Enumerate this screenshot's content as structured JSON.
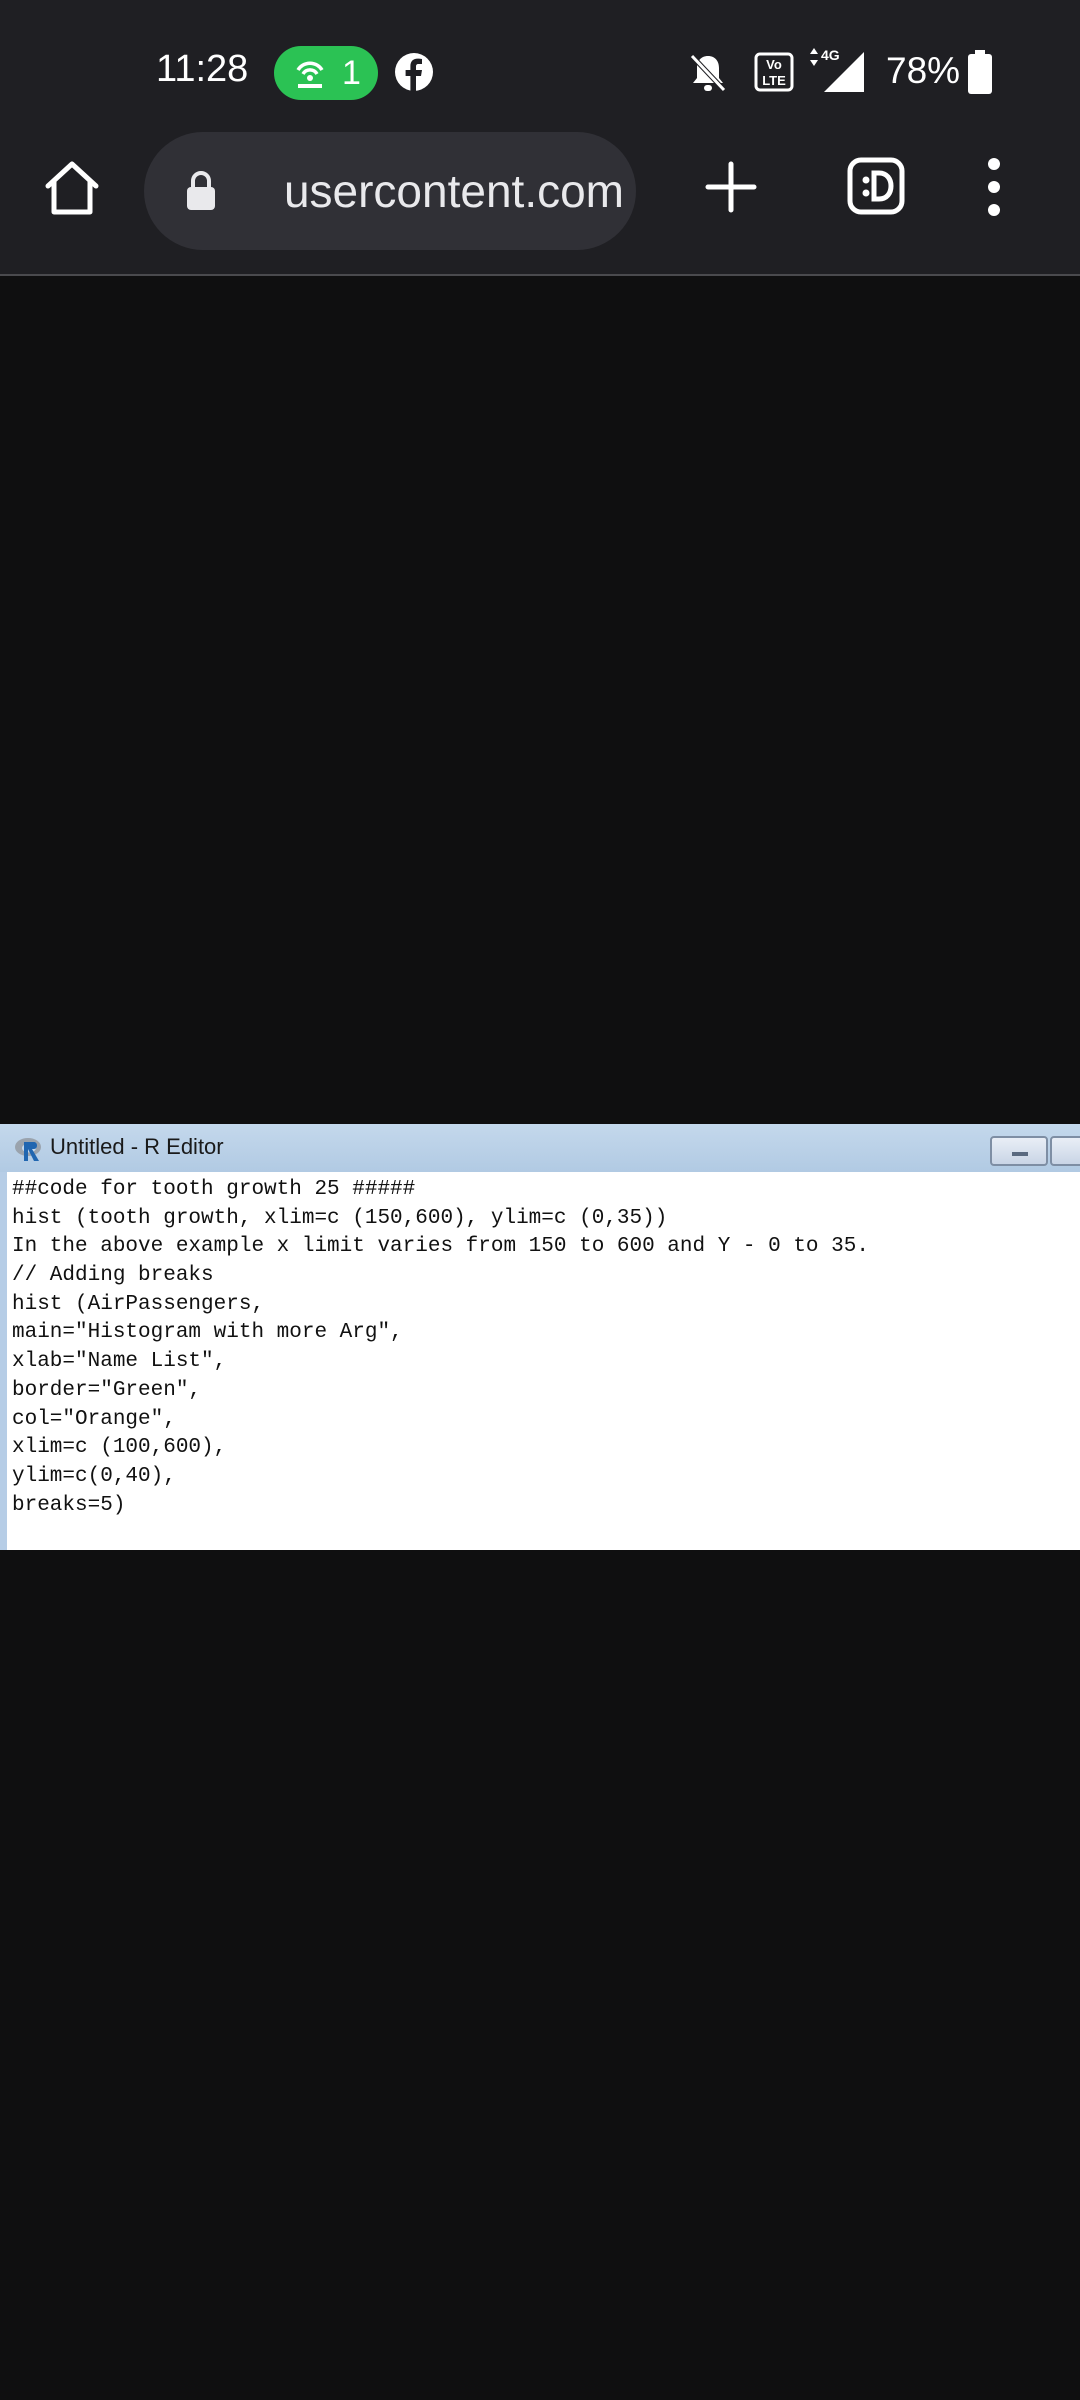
{
  "status_bar": {
    "time": "11:28",
    "hotspot_count": "1",
    "battery_percent": "78%",
    "icons": [
      "hotspot-icon",
      "facebook-icon",
      "bell-off-icon",
      "volte-icon",
      "signal-4g-icon",
      "battery-icon"
    ]
  },
  "browser": {
    "url_fragment": "usercontent.com",
    "icons": [
      "home-icon",
      "lock-icon",
      "plus-icon",
      "tab-switcher-icon",
      "more-vert-icon"
    ]
  },
  "r_editor": {
    "title": "Untitled - R Editor",
    "code_lines": [
      "##code for tooth growth 25 #####",
      "hist (tooth growth, xlim=c (150,600), ylim=c (0,35))",
      "In the above example x limit varies from 150 to 600 and Y - 0 to 35.",
      "// Adding breaks",
      "hist (AirPassengers,",
      "main=\"Histogram with more Arg\",",
      "xlab=\"Name List\",",
      "border=\"Green\",",
      "col=\"Orange\",",
      "xlim=c (100,600),",
      "ylim=c(0,40),",
      "breaks=5)"
    ]
  },
  "colors": {
    "background": "#0f0f10",
    "toolbar": "#1f1f23",
    "hotspot_green": "#2bc254",
    "r_titlebar": "#c4d8ec"
  }
}
